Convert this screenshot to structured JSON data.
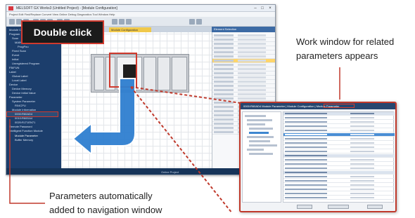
{
  "main_window": {
    "title": "MELSOFT GX Works3 (Untitled Project) - [Module Configuration]",
    "menu": "Project  Edit  Find/Replace  Convert  View  Online  Debug  Diagnostics  Tool  Window  Help",
    "diagram_tab": "Module Configuration",
    "property_header": "Element Selection",
    "status": "Online  Project"
  },
  "navigation": {
    "items": [
      "Module Configuration",
      "Program",
      "Scan",
      "MAIN",
      "ProgPou",
      "Fixed Scan",
      "Event",
      "Initial",
      "Unregistered Program",
      "FB/FUN",
      "Label",
      "Global Label",
      "Local Label",
      "Device",
      "Device Memory",
      "Device Initial Value",
      "Parameter",
      "System Parameter",
      "R04CPU",
      "Module Information",
      "0000:R60AD4",
      "0010:R60DA4",
      "0020:RJ71EN71",
      "Remote Password",
      "Intelligent Function Module",
      "Module Parameter",
      "Buffer Memory"
    ]
  },
  "callouts": {
    "double_click": "Double click",
    "work_window_line1": "Work window for related",
    "work_window_line2": "parameters appears",
    "nav_line1": "Parameters automatically",
    "nav_line2": "added to navigation window"
  },
  "work_window": {
    "title": "0000:R60AD4 Module Parameter  |  Module Configuration  |  Module Parameter"
  },
  "colors": {
    "accent_red": "#d03a2e",
    "arrow_blue": "#2f7fd0",
    "nav_bg": "#1c3e6c"
  }
}
